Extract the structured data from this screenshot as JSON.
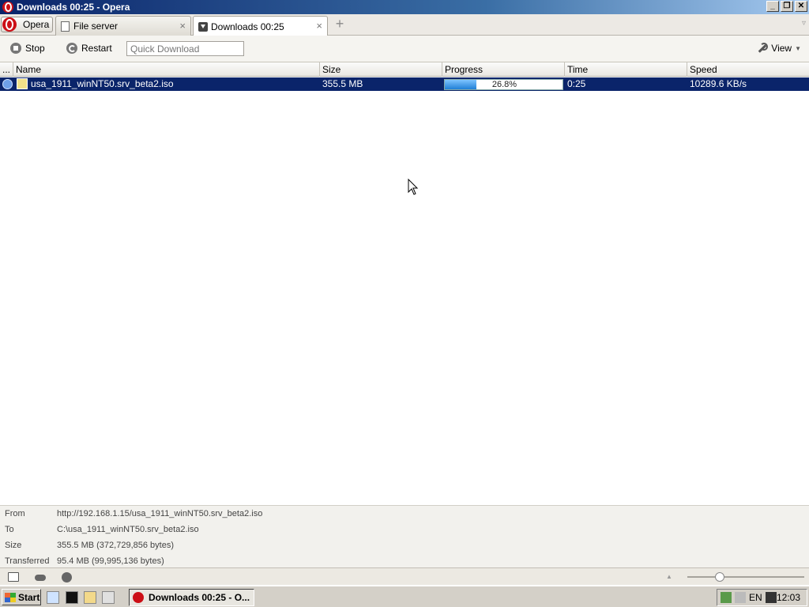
{
  "window": {
    "title": "Downloads 00:25 - Opera",
    "minimize": "_",
    "restore": "❐",
    "close": "✕"
  },
  "tabs": {
    "opera_menu_label": "Opera",
    "items": [
      {
        "label": "File server",
        "close": "×"
      },
      {
        "label": "Downloads 00:25",
        "close": "×"
      }
    ],
    "new_tab": "+"
  },
  "toolbar": {
    "stop_label": "Stop",
    "restart_label": "Restart",
    "quick_download_placeholder": "Quick Download",
    "view_label": "View"
  },
  "columns": {
    "menu": "...",
    "name": "Name",
    "size": "Size",
    "progress": "Progress",
    "time": "Time",
    "speed": "Speed"
  },
  "downloads": [
    {
      "name": "usa_1911_winNT50.srv_beta2.iso",
      "size": "355.5 MB",
      "progress_text": "26.8%",
      "progress": 0.268,
      "time": "0:25",
      "speed": "10289.6 KB/s"
    }
  ],
  "details": {
    "from_label": "From",
    "from_value": "http://192.168.1.15/usa_1911_winNT50.srv_beta2.iso",
    "to_label": "To",
    "to_value": "C:\\usa_1911_winNT50.srv_beta2.iso",
    "size_label": "Size",
    "size_value": "355.5 MB (372,729,856 bytes)",
    "transferred_label": "Transferred",
    "transferred_value": "95.4 MB (99,995,136 bytes)"
  },
  "taskbar": {
    "start_label": "Start",
    "task_label": "Downloads 00:25 - O...",
    "lang": "EN",
    "clock": "12:03"
  },
  "colors": {
    "selection": "#0a246a",
    "opera_red": "#cc0f16",
    "progress_fill": "#1f7fd6"
  }
}
